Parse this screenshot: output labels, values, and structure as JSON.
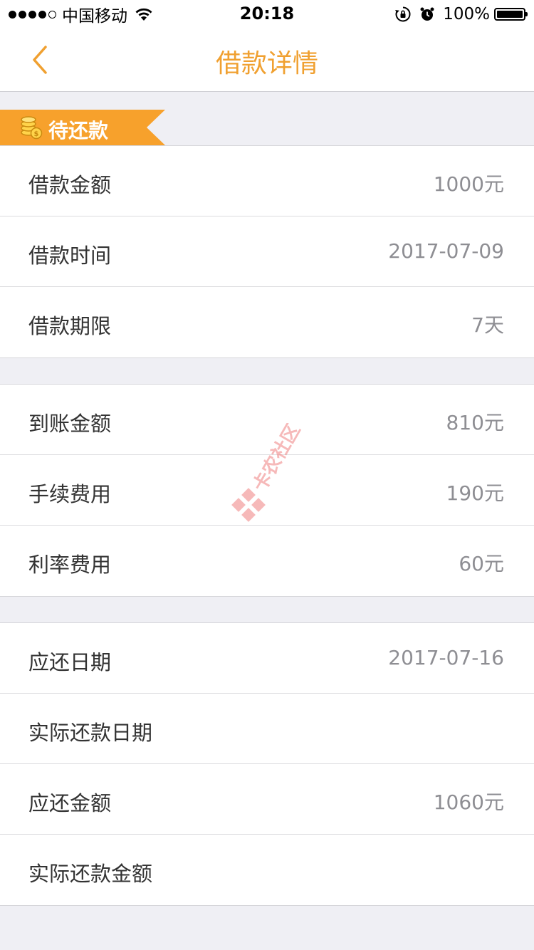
{
  "status_bar": {
    "carrier": "中国移动",
    "time": "20:18",
    "battery": "100%",
    "battery_level": 1.0
  },
  "nav": {
    "title": "借款详情"
  },
  "ribbon": {
    "label": "待还款",
    "color": "#f7a12c"
  },
  "groups": [
    {
      "rows": [
        {
          "label": "借款金额",
          "value": "1000元"
        },
        {
          "label": "借款时间",
          "value": "2017-07-09"
        },
        {
          "label": "借款期限",
          "value": "7天"
        }
      ]
    },
    {
      "rows": [
        {
          "label": "到账金额",
          "value": "810元"
        },
        {
          "label": "手续费用",
          "value": "190元"
        },
        {
          "label": "利率费用",
          "value": "60元"
        }
      ]
    },
    {
      "rows": [
        {
          "label": "应还日期",
          "value": "2017-07-16"
        },
        {
          "label": "实际还款日期",
          "value": ""
        },
        {
          "label": "应还金额",
          "value": "1060元"
        },
        {
          "label": "实际还款金额",
          "value": ""
        }
      ]
    }
  ],
  "watermark": {
    "text": "卡农社区"
  },
  "colors": {
    "accent": "#f0a030",
    "background": "#efeff4",
    "label_text": "#333333",
    "value_text": "#8e8e93"
  }
}
